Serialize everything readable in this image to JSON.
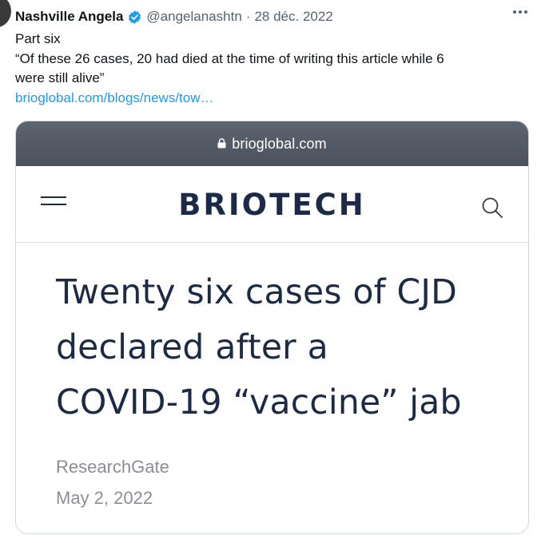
{
  "tweet": {
    "author_name": "Nashville Angela",
    "handle": "@angelanashtn",
    "separator": "·",
    "date": "28 déc. 2022",
    "text_lines": [
      "Part six",
      "“Of these 26 cases, 20 had died at the time of writing this article while 6",
      "were still alive”"
    ],
    "link_text": "brioglobal.com/blogs/news/tow…",
    "more_icon": "more-horizontal-icon",
    "verified_icon": "verified-badge-icon"
  },
  "media": {
    "browser_domain": "brioglobal.com",
    "lock_icon": "lock-icon",
    "menu_icon": "hamburger-menu-icon",
    "brand_logo": "BRIOTECH",
    "search_icon": "search-icon",
    "article": {
      "title_lines": [
        "Twenty six cases of CJD",
        "declared after a",
        "COVID-19 “vaccine” jab"
      ],
      "source": "ResearchGate",
      "date": "May 2, 2022"
    }
  },
  "colors": {
    "link": "#1d9bf0",
    "verified": "#1d9bf0",
    "brand": "#1c2a45",
    "browser_bar": "#545b67",
    "muted": "#536471"
  }
}
